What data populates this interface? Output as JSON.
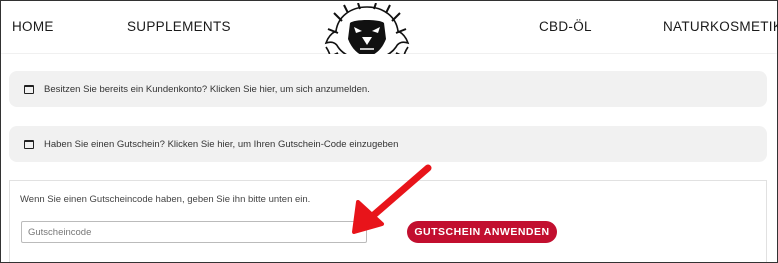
{
  "nav": {
    "home": "HOME",
    "supplements": "SUPPLEMENTS",
    "cbd": "CBD-ÖL",
    "naturkosmetik": "NATURKOSMETIK"
  },
  "logo_icon": "lion-head-logo",
  "notices": [
    {
      "icon": "window-icon",
      "text": "Besitzen Sie bereits ein Kundenkonto? Klicken Sie hier, um sich anzumelden."
    },
    {
      "icon": "window-icon",
      "text": "Haben Sie einen Gutschein? Klicken Sie hier, um Ihren Gutschein-Code einzugeben"
    }
  ],
  "coupon": {
    "info": "Wenn Sie einen Gutscheincode haben, geben Sie ihn bitte unten ein.",
    "placeholder": "Gutscheincode",
    "value": "",
    "apply_label": "GUTSCHEIN ANWENDEN"
  },
  "colors": {
    "accent": "#c20f2f",
    "annotation_arrow": "#e8141a",
    "notice_bg": "#f1f1f1"
  }
}
